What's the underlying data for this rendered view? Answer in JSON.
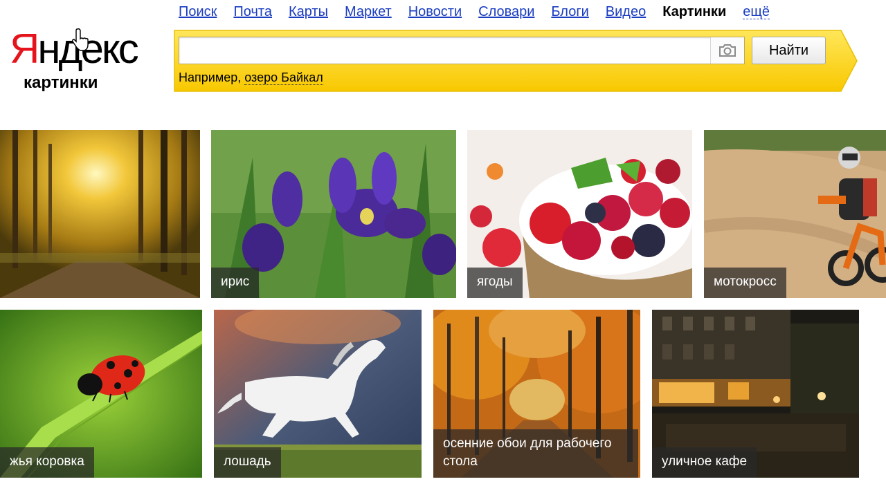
{
  "nav": {
    "items": [
      "Поиск",
      "Почта",
      "Карты",
      "Маркет",
      "Новости",
      "Словари",
      "Блоги",
      "Видео"
    ],
    "active": "Картинки",
    "more": "ещё"
  },
  "logo": {
    "first_letter": "Я",
    "rest": "ндекс",
    "subtitle": "картинки"
  },
  "search": {
    "value": "",
    "button_label": "Найти",
    "example_prefix": "Например,",
    "example_link": "озеро Байкал"
  },
  "tiles": [
    {
      "caption": ""
    },
    {
      "caption": "ирис"
    },
    {
      "caption": "ягоды"
    },
    {
      "caption": "мотокросс"
    },
    {
      "caption": "жья коровка"
    },
    {
      "caption": "лошадь"
    },
    {
      "caption": "осенние обои для рабочего стола"
    },
    {
      "caption": "уличное кафе"
    }
  ],
  "colors": {
    "nav_link": "#1a3dc1",
    "logo_red": "#e5141c",
    "band_yellow": "#ffd91a",
    "band_border": "#e8c000"
  },
  "icons": {
    "camera": "camera-icon",
    "cursor": "hand-cursor-icon"
  }
}
